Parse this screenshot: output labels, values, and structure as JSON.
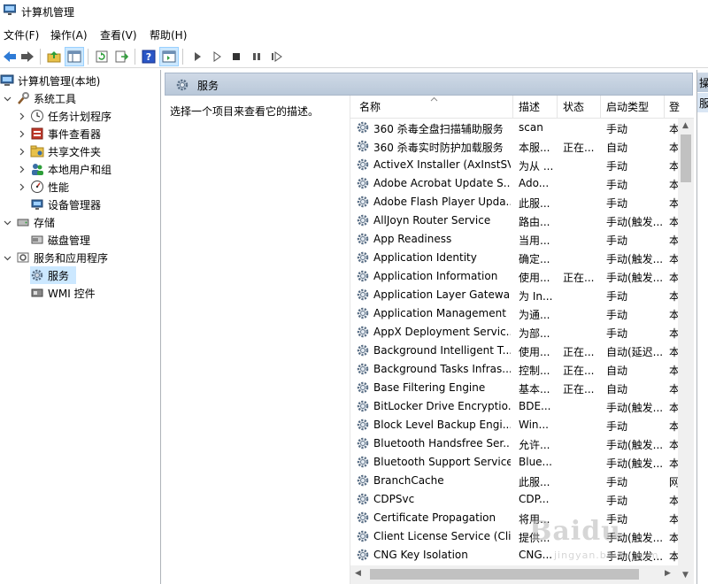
{
  "window": {
    "title": "计算机管理"
  },
  "menu": [
    "文件(F)",
    "操作(A)",
    "查看(V)",
    "帮助(H)"
  ],
  "tree": {
    "root": "计算机管理(本地)",
    "system_tools": "系统工具",
    "task_scheduler": "任务计划程序",
    "event_viewer": "事件查看器",
    "shared_folders": "共享文件夹",
    "local_users": "本地用户和组",
    "performance": "性能",
    "device_manager": "设备管理器",
    "storage": "存储",
    "disk_management": "磁盘管理",
    "services_apps": "服务和应用程序",
    "services": "服务",
    "wmi": "WMI 控件"
  },
  "pane": {
    "header": "服务",
    "description": "选择一个项目来查看它的描述。"
  },
  "columns": {
    "name": "名称",
    "description": "描述",
    "status": "状态",
    "startup": "启动类型",
    "logon": "登"
  },
  "services": [
    {
      "name": "360 杀毒全盘扫描辅助服务",
      "desc": "scan",
      "status": "",
      "startup": "手动",
      "logon": "本"
    },
    {
      "name": "360 杀毒实时防护加载服务",
      "desc": "本服...",
      "status": "正在...",
      "startup": "自动",
      "logon": "本"
    },
    {
      "name": "ActiveX Installer (AxInstSV)",
      "desc": "为从 ...",
      "status": "",
      "startup": "手动",
      "logon": "本"
    },
    {
      "name": "Adobe Acrobat Update S...",
      "desc": "Ado...",
      "status": "",
      "startup": "手动",
      "logon": "本"
    },
    {
      "name": "Adobe Flash Player Upda...",
      "desc": "此服...",
      "status": "",
      "startup": "手动",
      "logon": "本"
    },
    {
      "name": "AllJoyn Router Service",
      "desc": "路由...",
      "status": "",
      "startup": "手动(触发...",
      "logon": "本"
    },
    {
      "name": "App Readiness",
      "desc": "当用...",
      "status": "",
      "startup": "手动",
      "logon": "本"
    },
    {
      "name": "Application Identity",
      "desc": "确定...",
      "status": "",
      "startup": "手动(触发...",
      "logon": "本"
    },
    {
      "name": "Application Information",
      "desc": "使用...",
      "status": "正在...",
      "startup": "手动(触发...",
      "logon": "本"
    },
    {
      "name": "Application Layer Gatewa...",
      "desc": "为 In...",
      "status": "",
      "startup": "手动",
      "logon": "本"
    },
    {
      "name": "Application Management",
      "desc": "为通...",
      "status": "",
      "startup": "手动",
      "logon": "本"
    },
    {
      "name": "AppX Deployment Servic...",
      "desc": "为部...",
      "status": "",
      "startup": "手动",
      "logon": "本"
    },
    {
      "name": "Background Intelligent T...",
      "desc": "使用...",
      "status": "正在...",
      "startup": "自动(延迟...",
      "logon": "本"
    },
    {
      "name": "Background Tasks Infras...",
      "desc": "控制...",
      "status": "正在...",
      "startup": "自动",
      "logon": "本"
    },
    {
      "name": "Base Filtering Engine",
      "desc": "基本...",
      "status": "正在...",
      "startup": "自动",
      "logon": "本"
    },
    {
      "name": "BitLocker Drive Encryptio...",
      "desc": "BDE...",
      "status": "",
      "startup": "手动(触发...",
      "logon": "本"
    },
    {
      "name": "Block Level Backup Engi...",
      "desc": "Win...",
      "status": "",
      "startup": "手动",
      "logon": "本"
    },
    {
      "name": "Bluetooth Handsfree Ser...",
      "desc": "允许...",
      "status": "",
      "startup": "手动(触发...",
      "logon": "本"
    },
    {
      "name": "Bluetooth Support Service",
      "desc": "Blue...",
      "status": "",
      "startup": "手动(触发...",
      "logon": "本"
    },
    {
      "name": "BranchCache",
      "desc": "此服...",
      "status": "",
      "startup": "手动",
      "logon": "网"
    },
    {
      "name": "CDPSvc",
      "desc": "CDP...",
      "status": "",
      "startup": "手动",
      "logon": "本"
    },
    {
      "name": "Certificate Propagation",
      "desc": "将用...",
      "status": "",
      "startup": "手动",
      "logon": "本"
    },
    {
      "name": "Client License Service (Cli...",
      "desc": "提供...",
      "status": "",
      "startup": "手动(触发...",
      "logon": "本"
    },
    {
      "name": "CNG Key Isolation",
      "desc": "CNG...",
      "status": "",
      "startup": "手动(触发...",
      "logon": "本"
    }
  ],
  "actions": {
    "header": "操",
    "item": "服"
  },
  "watermark": {
    "brand": "Baidu",
    "url": "jingyan.baidu.com"
  },
  "colors": {
    "selection": "#cce8ff",
    "pane_header": "#c4d2e2",
    "border": "#aeb3b9"
  }
}
